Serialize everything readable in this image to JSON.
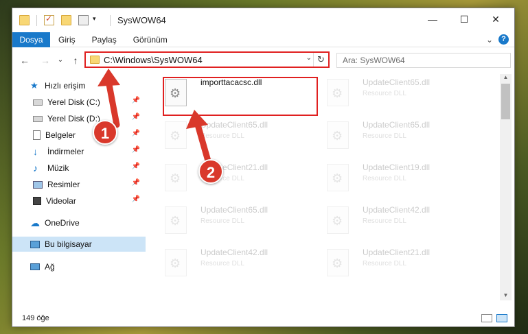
{
  "window": {
    "title": "SysWOW64",
    "minimize_icon": "—",
    "maximize_icon": "☐",
    "close_icon": "✕"
  },
  "ribbon": {
    "tabs": [
      "Dosya",
      "Giriş",
      "Paylaş",
      "Görünüm"
    ],
    "expand_icon": "⌄",
    "help_icon": "?"
  },
  "nav": {
    "back_icon": "←",
    "forward_icon": "→",
    "recent_icon": "⌄",
    "up_icon": "↑",
    "address": "C:\\Windows\\SysWOW64",
    "address_drop": "⌄",
    "refresh_icon": "↻",
    "search_placeholder": "Ara: SysWOW64"
  },
  "sidebar": {
    "items": [
      {
        "label": "Hızlı erişim",
        "icon": "star-icon",
        "pinned": false
      },
      {
        "label": "Yerel Disk (C:)",
        "icon": "drive-icon",
        "pinned": true
      },
      {
        "label": "Yerel Disk (D:)",
        "icon": "drive-icon",
        "pinned": true
      },
      {
        "label": "Belgeler",
        "icon": "documents-icon",
        "pinned": true
      },
      {
        "label": "İndirmeler",
        "icon": "download-icon",
        "pinned": true
      },
      {
        "label": "Müzik",
        "icon": "music-icon",
        "pinned": true
      },
      {
        "label": "Resimler",
        "icon": "pictures-icon",
        "pinned": true
      },
      {
        "label": "Videolar",
        "icon": "videos-icon",
        "pinned": true
      },
      {
        "label": "OneDrive",
        "icon": "cloud-icon",
        "pinned": false
      },
      {
        "label": "Bu bilgisayar",
        "icon": "computer-icon",
        "pinned": false
      },
      {
        "label": "Ağ",
        "icon": "network-icon",
        "pinned": false
      }
    ]
  },
  "files": [
    {
      "name": "importtacacsc.dll",
      "type": "",
      "highlighted": true
    },
    {
      "name": "UpdateClient65.dll",
      "type": "Resource DLL",
      "highlighted": false
    },
    {
      "name": "UpdateClient65.dll",
      "type": "Resource DLL",
      "highlighted": false
    },
    {
      "name": "UpdateClient65.dll",
      "type": "Resource DLL",
      "highlighted": false
    },
    {
      "name": "UpdateClient21.dll",
      "type": "Resource DLL",
      "highlighted": false
    },
    {
      "name": "UpdateClient19.dll",
      "type": "Resource DLL",
      "highlighted": false
    },
    {
      "name": "UpdateClient65.dll",
      "type": "Resource DLL",
      "highlighted": false
    },
    {
      "name": "UpdateClient42.dll",
      "type": "Resource DLL",
      "highlighted": false
    },
    {
      "name": "UpdateClient42.dll",
      "type": "Resource DLL",
      "highlighted": false
    },
    {
      "name": "UpdateClient21.dll",
      "type": "Resource DLL",
      "highlighted": false
    }
  ],
  "status": {
    "count": "149 öğe"
  },
  "annotations": {
    "badge1": "1",
    "badge2": "2",
    "highlight_color": "#e02020",
    "badge_color": "#d9382b"
  },
  "colors": {
    "accent": "#1979ca",
    "selected": "#cce4f7"
  }
}
